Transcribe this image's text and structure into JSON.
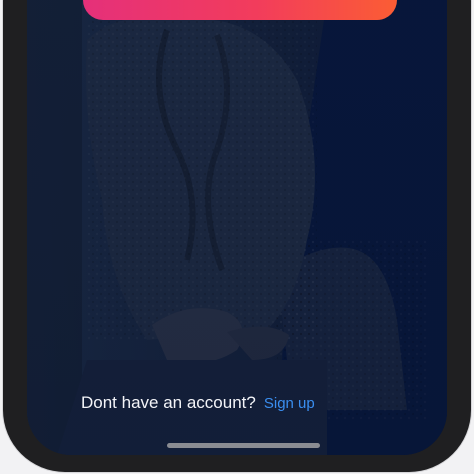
{
  "auth_footer": {
    "prompt": "Dont have an account?",
    "link_label": "Sign up"
  },
  "colors": {
    "button_gradient_start": "#e5307a",
    "button_gradient_end": "#fb5d34",
    "link": "#3a8ef0",
    "prompt_text": "#f3f4f8",
    "background_tint": "#0c1a36",
    "device_frame": "#1f1f21"
  },
  "icons": {
    "home_indicator": "home-indicator-bar"
  }
}
